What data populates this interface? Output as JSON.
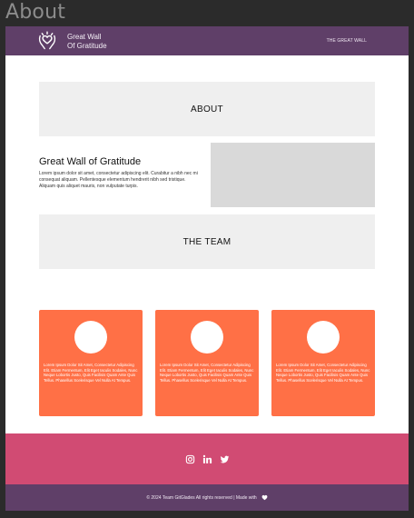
{
  "canvas": {
    "label": "About"
  },
  "nav": {
    "brand_line1": "Great Wall",
    "brand_line2": "Of Gratitude",
    "link": "THE GREAT WALL",
    "logo_icon": "heart-hands-logo-icon"
  },
  "about": {
    "banner": "ABOUT",
    "title": "Great Wall of Gratitude",
    "text": "Lorem ipsum dolor sit amet, consectetur adipiscing elit. Curabitur a nibh nec mi consequat aliquam. Pellentesque elementum hendrerit nibh sed tristique. Aliquam quis aliquet mauris, non vulputate turpis."
  },
  "team": {
    "banner": "THE TEAM",
    "members": [
      {
        "text": "Lorem Ipsum Dolor Sit Amet, Consectetur Adipiscing Elit. Etiam Fermentum, Elit Eget Iaculis Sodales, Nunc Neque Lobortis Justo, Quis Facilisis Quam Ante Quis Tellus. Phasellus Scelerisque Vel Nulla At Tempus."
      },
      {
        "text": "Lorem Ipsum Dolor Sit Amet, Consectetur Adipiscing Elit. Etiam Fermentum, Elit Eget Iaculis Sodales, Nunc Neque Lobortis Justo, Quis Facilisis Quam Ante Quis Tellus. Phasellus Scelerisque Vel Nulla At Tempus."
      },
      {
        "text": "Lorem Ipsum Dolor Sit Amet, Consectetur Adipiscing Elit. Etiam Fermentum, Elit Eget Iaculis Sodales, Nunc Neque Lobortis Justo, Quis Facilisis Quam Ante Quis Tellus. Phasellus Scelerisque Vel Nulla At Tempus."
      }
    ]
  },
  "social": {
    "icons": [
      "instagram-icon",
      "linkedin-icon",
      "twitter-icon"
    ]
  },
  "footer": {
    "text": "© 2024 Team GitGlades All rights reserved | Made with",
    "icon": "heart-icon"
  },
  "colors": {
    "nav": "#5f3f68",
    "card": "#ff7046",
    "social_band": "#d14b73",
    "banner": "#efefef",
    "image_placeholder": "#d9d9d9"
  }
}
